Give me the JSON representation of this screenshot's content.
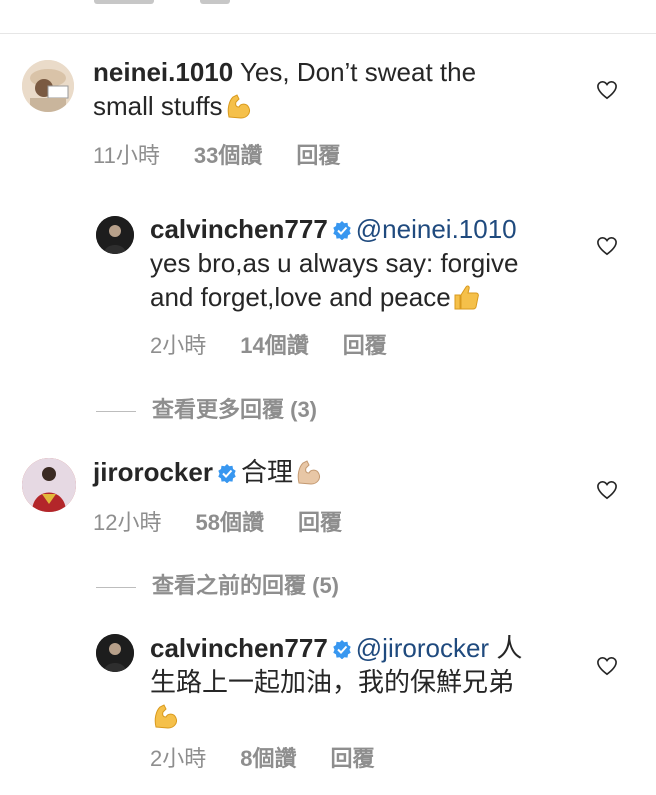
{
  "comments": [
    {
      "username": "neinei.1010",
      "text_line1": "Yes, Don’t sweat the",
      "text_line2": "small stuffs",
      "emoji": "flexed-biceps",
      "time": "11小時",
      "likes": "33個讚",
      "reply": "回覆"
    },
    {
      "username": "calvinchen777",
      "verified": true,
      "mention": "@neinei.1010",
      "text_line1": "yes bro,as u always say: forgive",
      "text_line2": "and forget,love and peace",
      "emoji": "thumbs-up",
      "time": "2小時",
      "likes": "14個讚",
      "reply": "回覆"
    },
    {
      "username": "jirorocker",
      "verified": true,
      "text": "合理",
      "emoji": "flexed-biceps",
      "time": "12小時",
      "likes": "58個讚",
      "reply": "回覆"
    },
    {
      "username": "calvinchen777",
      "verified": true,
      "mention": "@jirorocker",
      "text_line1_suffix": "人",
      "text_line2": "生路上一起加油，我的保鮮兄弟",
      "emoji": "flexed-biceps",
      "time": "2小時",
      "likes": "8個讚",
      "reply": "回覆"
    }
  ],
  "view_more_replies_1": "查看更多回覆 (3)",
  "view_previous_replies": "查看之前的回覆 (5)",
  "colors": {
    "text": "#262626",
    "muted": "#8e8e8e",
    "mention": "#1f4a7e",
    "verified": "#3897f0",
    "emoji": "#f5c04a"
  },
  "icons": [
    "heart-icon",
    "verified-badge-icon",
    "flexed-biceps-emoji",
    "thumbs-up-emoji"
  ]
}
